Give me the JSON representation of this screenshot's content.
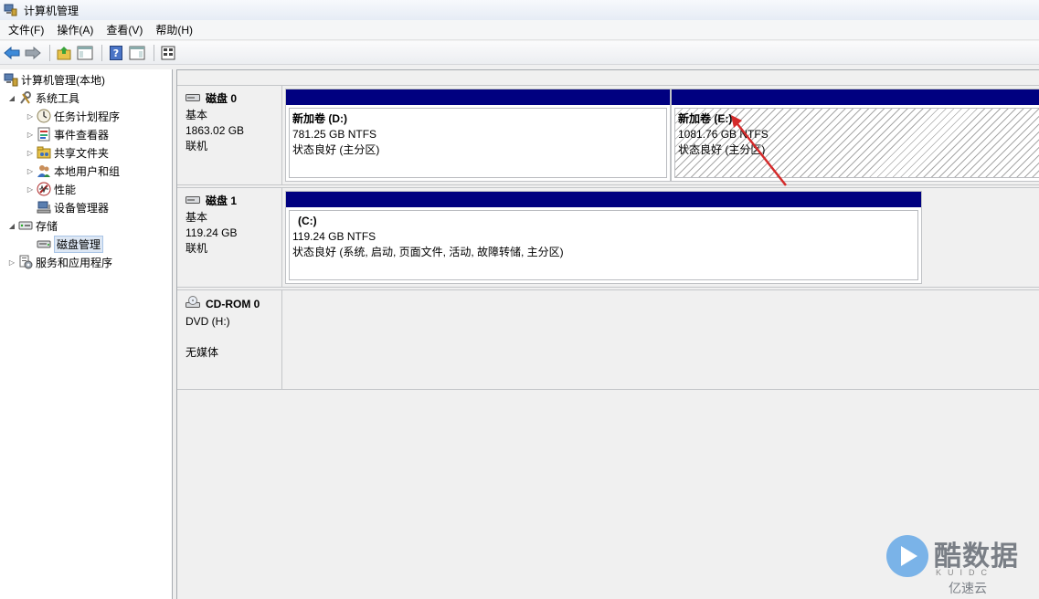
{
  "window": {
    "title": "计算机管理"
  },
  "menu": [
    "文件(F)",
    "操作(A)",
    "查看(V)",
    "帮助(H)"
  ],
  "toolbar": {
    "icons": [
      "back-arrow-icon",
      "forward-arrow-icon",
      "up-folder-icon",
      "show-hide-tree-icon",
      "help-icon",
      "properties-icon",
      "export-icon"
    ]
  },
  "tree": {
    "root": "计算机管理(本地)",
    "system_tools": "系统工具",
    "task_scheduler": "任务计划程序",
    "event_viewer": "事件查看器",
    "shared_folders": "共享文件夹",
    "local_users": "本地用户和组",
    "performance": "性能",
    "device_manager": "设备管理器",
    "storage": "存储",
    "disk_management": "磁盘管理",
    "services_apps": "服务和应用程序"
  },
  "disks": [
    {
      "name": "磁盘 0",
      "type": "基本",
      "size": "1863.02 GB",
      "status": "联机",
      "partitions": [
        {
          "name": "新加卷  (D:)",
          "size": "781.25 GB NTFS",
          "status": "状态良好 (主分区)"
        },
        {
          "name": "新加卷  (E:)",
          "size": "1081.76 GB NTFS",
          "status": "状态良好 (主分区)"
        }
      ]
    },
    {
      "name": "磁盘 1",
      "type": "基本",
      "size": "119.24 GB",
      "status": "联机",
      "partitions": [
        {
          "name": "(C:)",
          "size": "119.24 GB NTFS",
          "status": "状态良好 (系统, 启动, 页面文件, 活动, 故障转储, 主分区)"
        }
      ]
    },
    {
      "name": "CD-ROM 0",
      "type": "DVD (H:)",
      "media": "无媒体"
    }
  ],
  "watermark": {
    "brand": "酷数据",
    "sub": "KUIDC",
    "yisu": "亿速云"
  }
}
